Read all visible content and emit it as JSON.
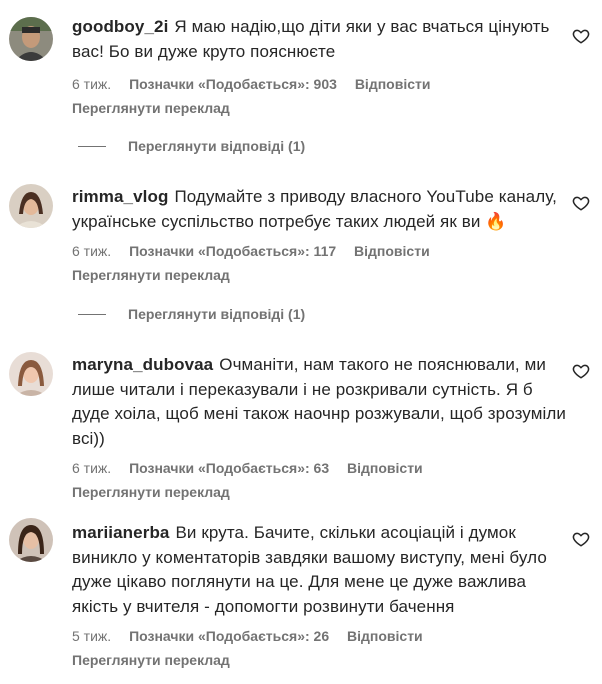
{
  "comments": [
    {
      "username": "goodboy_2i",
      "text": "Я маю надію,що діти яки у вас вчаться цінують вас! Бо ви дуже круто пояснюєте",
      "time": "6 тиж.",
      "likes": "Позначки «Подобається»: 903",
      "reply": "Відповісти",
      "translate": "Переглянути переклад",
      "view_replies": "Переглянути відповіді (1)",
      "avatar_icon": "user-avatar"
    },
    {
      "username": "rimma_vlog",
      "text": "Подумайте з приводу власного YouTube каналу, українське суспільство потребує таких людей як ви 🔥",
      "time": "6 тиж.",
      "likes": "Позначки «Подобається»: 117",
      "reply": "Відповісти",
      "translate": "Переглянути переклад",
      "view_replies": "Переглянути відповіді (1)",
      "avatar_icon": "user-avatar"
    },
    {
      "username": "maryna_dubovaa",
      "text": "Очманіти, нам такого не пояснювали, ми лише читали і переказували і не розкривали сутність. Я б дуде хоіла, щоб мені також наочнр розжували, щоб зрозуміли всі))",
      "time": "6 тиж.",
      "likes": "Позначки «Подобається»: 63",
      "reply": "Відповісти",
      "translate": "Переглянути переклад",
      "avatar_icon": "user-avatar"
    },
    {
      "username": "mariianerba",
      "text": "Ви крута. Бачите, скільки асоціацій і думок виникло у коментаторів завдяки вашому виступу, мені було дуже цікаво поглянути на це. Для мене це дуже важлива якість у вчителя - допомогти розвинути бачення",
      "time": "5 тиж.",
      "likes": "Позначки «Подобається»: 26",
      "reply": "Відповісти",
      "translate": "Переглянути переклад",
      "avatar_icon": "user-avatar"
    }
  ],
  "icons": {
    "like": "heart-outline-icon"
  },
  "colors": {
    "text": "#262626",
    "secondary": "#737373",
    "background": "#ffffff"
  }
}
